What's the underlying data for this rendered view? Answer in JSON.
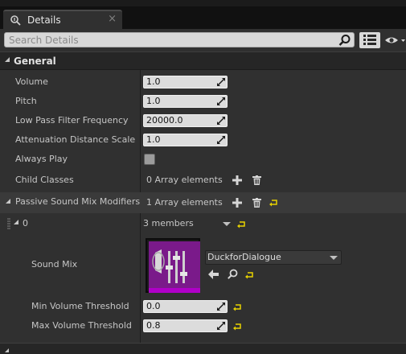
{
  "tab": {
    "title": "Details",
    "close": "×"
  },
  "search": {
    "placeholder": "Search Details"
  },
  "general": {
    "category_label": "General",
    "rows": [
      {
        "label": "Volume",
        "value": "1.0"
      },
      {
        "label": "Pitch",
        "value": "1.0"
      },
      {
        "label": "Low Pass Filter Frequency",
        "value": "20000.0"
      },
      {
        "label": "Attenuation Distance Scale",
        "value": "1.0"
      }
    ],
    "always_play": {
      "label": "Always Play",
      "checked": false
    },
    "child_classes": {
      "label": "Child Classes",
      "value": "0 Array elements"
    },
    "passive": {
      "label": "Passive Sound Mix Modifiers",
      "value": "1 Array elements"
    },
    "element": {
      "index": "0",
      "members": "3 members",
      "sound_mix": {
        "label": "Sound Mix",
        "asset": "DuckforDialogue"
      },
      "min_volume": {
        "label": "Min Volume Threshold",
        "value": "0.0"
      },
      "max_volume": {
        "label": "Max Volume Threshold",
        "value": "0.8"
      }
    }
  },
  "colors": {
    "panel": "#303030",
    "accent_yellow": "#e8d200",
    "thumbnail_purple": "#7a1a8a"
  },
  "icons": {
    "tab": "details-icon",
    "search": "search-icon",
    "view_options": "view-options-icon",
    "visibility": "eye-icon",
    "add": "plus-icon",
    "delete": "trash-icon",
    "reset": "reset-to-default-icon",
    "use_selected": "arrow-left-icon",
    "browse": "browse-icon"
  }
}
